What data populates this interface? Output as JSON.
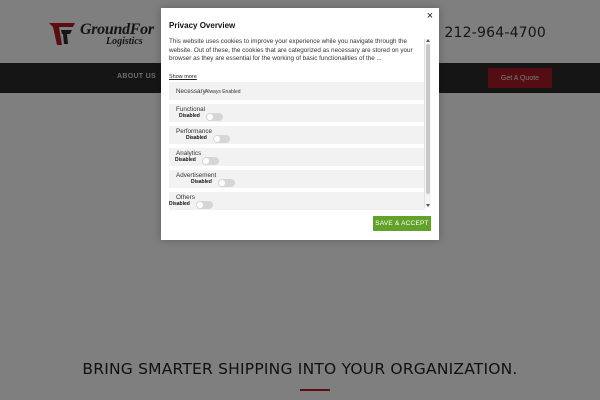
{
  "brand": {
    "name": "GroundFor",
    "sub": "Logistics",
    "accent": "#b71c25"
  },
  "header": {
    "phone": "212-964-4700"
  },
  "nav": {
    "items": [
      {
        "label": ""
      },
      {
        "label": "ABOUT US"
      }
    ],
    "quote_label": "Get A Quote"
  },
  "hero": {
    "tagline": "BRING SMARTER SHIPPING INTO YOUR ORGANIZATION."
  },
  "modal": {
    "title": "Privacy Overview",
    "close_glyph": "×",
    "description": "This website uses cookies to improve your experience while you navigate through the website. Out of these, the cookies that are categorized as necessary are stored on your browser as they are essential for the working of basic functionalities of the ...",
    "show_more": "Show more",
    "necessary": {
      "label": "Necessary",
      "status": "Always Enabled"
    },
    "categories": [
      {
        "label": "Functional",
        "state": "Disabled",
        "enabled": false
      },
      {
        "label": "Performance",
        "state": "Disabled",
        "enabled": false
      },
      {
        "label": "Analytics",
        "state": "Disabled",
        "enabled": false
      },
      {
        "label": "Advertisement",
        "state": "Disabled",
        "enabled": false
      },
      {
        "label": "Others",
        "state": "Disabled",
        "enabled": false
      }
    ],
    "save_label": "SAVE & ACCEPT",
    "save_color": "#61a229"
  }
}
